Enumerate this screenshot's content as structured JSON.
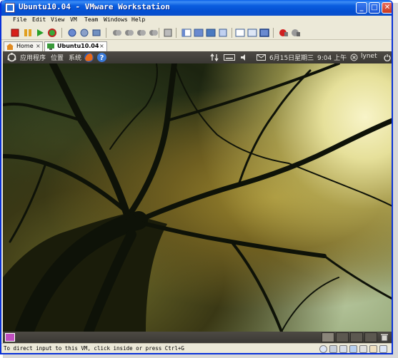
{
  "window": {
    "title": "Ubuntu10.04 - VMware Workstation",
    "controls": {
      "minimize": "_",
      "maximize": "□",
      "close": "✕"
    }
  },
  "menubar": {
    "items": [
      "File",
      "Edit",
      "View",
      "VM",
      "Team",
      "Windows",
      "Help"
    ]
  },
  "tabs": [
    {
      "label": "Home",
      "icon": "home-icon",
      "active": false
    },
    {
      "label": "Ubuntu10.04",
      "icon": "vm-icon",
      "active": true
    }
  ],
  "tab_close": "×",
  "guest_panel": {
    "menus": [
      "应用程序",
      "位置",
      "系统"
    ],
    "date": "6月15日星期三",
    "time": "9:04 上午",
    "user": "lynet"
  },
  "statusbar": {
    "message": "To direct input to this VM, click inside or press Ctrl+G"
  },
  "colors": {
    "titlebar": "#0a5fe8",
    "chrome": "#ece9d8",
    "guest_panel": "#3a3834"
  }
}
